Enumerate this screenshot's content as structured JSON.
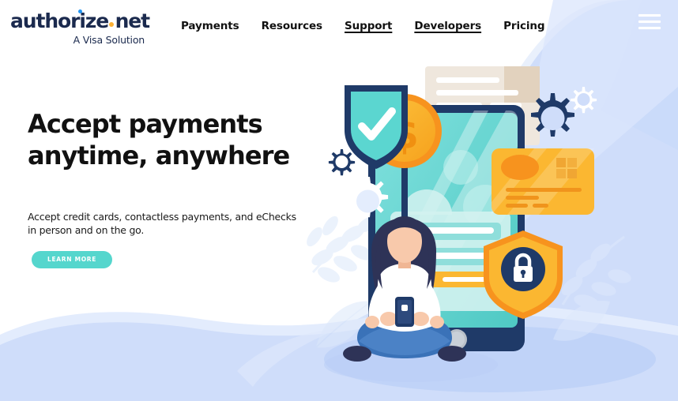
{
  "brand": {
    "logo_text_part1": "authorize",
    "logo_text_part2": "net",
    "logo_tagline": "A Visa Solution",
    "navy": "#1b2a4e",
    "blue_dot": "#2196f3",
    "orange_dot": "#fbb034"
  },
  "header": {
    "nav_items": [
      {
        "label": "Payments",
        "underlined": false
      },
      {
        "label": "Resources",
        "underlined": false
      },
      {
        "label": "Support",
        "underlined": true
      },
      {
        "label": "Developers",
        "underlined": true
      },
      {
        "label": "Pricing",
        "underlined": false
      }
    ],
    "menu_icon": "hamburger-menu-icon"
  },
  "hero": {
    "title": "Accept payments anytime, anywhere",
    "subtitle": "Accept credit cards, contactless payments, and eChecks in person and on the go.",
    "cta_label": "LEARN MORE",
    "cta_color": "#55d6cd"
  },
  "illustration": {
    "alt": "Woman sitting cross-legged with a phone in front of a tablet showing a login form, surrounded by payment icons",
    "elements": [
      "security-shield-check-icon",
      "dollar-coin-icon",
      "receipt-document-icon",
      "navy-gear-icon",
      "white-gear-icon",
      "credit-card-icon",
      "padlock-shield-icon",
      "tablet-device",
      "login-form-card",
      "seated-person",
      "leaf-branch-decoration"
    ],
    "palette": {
      "teal": "#5bd6d0",
      "navy": "#1f3a68",
      "orange": "#f7931e",
      "yellow": "#fbb731",
      "cream": "#ece3d8",
      "sky": "#c6d8f7",
      "pale_blue": "#e6edfb",
      "white": "#ffffff",
      "skin": "#f8c9ab",
      "denim": "#3a72b8"
    }
  }
}
